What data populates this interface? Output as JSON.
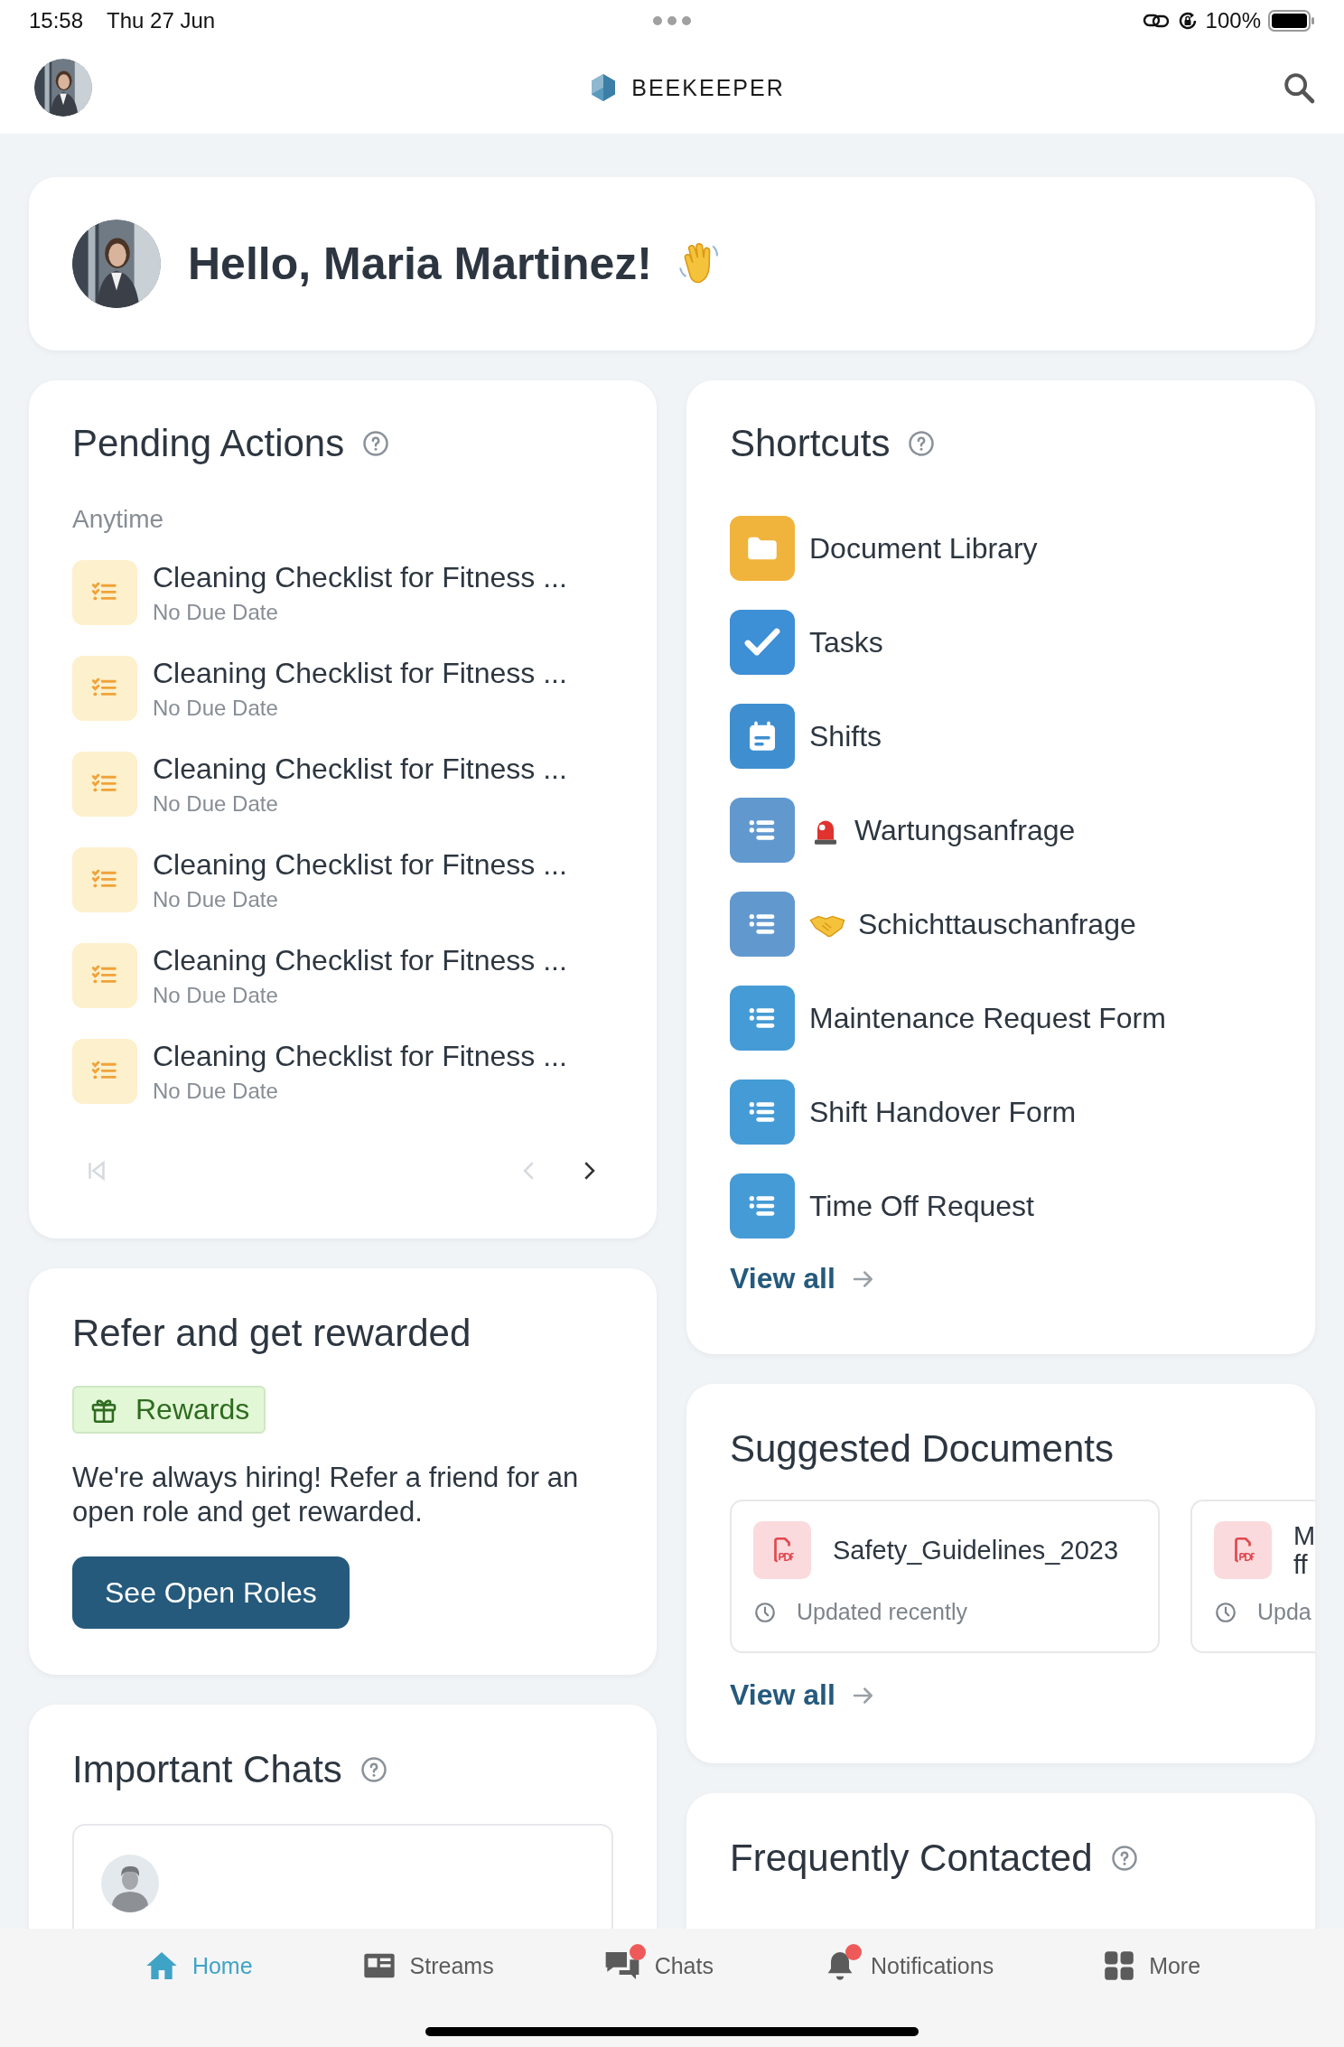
{
  "status_bar": {
    "time": "15:58",
    "date": "Thu 27 Jun",
    "battery": "100%"
  },
  "header": {
    "logo_text": "BEEKEEPER"
  },
  "greeting": {
    "text": "Hello, Maria Martinez!"
  },
  "pending_actions": {
    "title": "Pending Actions",
    "group": "Anytime",
    "items": [
      {
        "title": "Cleaning Checklist for Fitness ...",
        "due": "No Due Date"
      },
      {
        "title": "Cleaning Checklist for Fitness ...",
        "due": "No Due Date"
      },
      {
        "title": "Cleaning Checklist for Fitness ...",
        "due": "No Due Date"
      },
      {
        "title": "Cleaning Checklist for Fitness ...",
        "due": "No Due Date"
      },
      {
        "title": "Cleaning Checklist for Fitness ...",
        "due": "No Due Date"
      },
      {
        "title": "Cleaning Checklist for Fitness ...",
        "due": "No Due Date"
      }
    ],
    "pagination": {
      "first_disabled": true,
      "prev_disabled": true,
      "next_disabled": false
    }
  },
  "referral": {
    "title": "Refer and get rewarded",
    "tag": "Rewards",
    "text": "We're always hiring! Refer a friend for an open role and get rewarded.",
    "button": "See Open Roles"
  },
  "important_chats": {
    "title": "Important Chats"
  },
  "shortcuts": {
    "title": "Shortcuts",
    "items": [
      {
        "kind": "folder",
        "label": "Document Library"
      },
      {
        "kind": "tasks",
        "label": "Tasks"
      },
      {
        "kind": "shifts",
        "label": "Shifts"
      },
      {
        "kind": "siren_form",
        "label": "Wartungsanfrage"
      },
      {
        "kind": "handshake_form",
        "label": "Schichttauschanfrage"
      },
      {
        "kind": "form",
        "label": "Maintenance Request Form"
      },
      {
        "kind": "form",
        "label": "Shift Handover Form"
      },
      {
        "kind": "form",
        "label": "Time Off Request"
      }
    ],
    "view_all": "View all"
  },
  "suggested_documents": {
    "title": "Suggested Documents",
    "items": [
      {
        "name_lines": [
          "Safety_Guidelines_2023"
        ],
        "updated": "Updated recently"
      },
      {
        "name_lines": [
          "M",
          "ff"
        ],
        "updated": "Upda"
      }
    ],
    "view_all": "View all"
  },
  "frequently_contacted": {
    "title": "Frequently Contacted"
  },
  "bottom_nav": [
    {
      "kind": "home",
      "label": "Home",
      "selected": true,
      "badge": false
    },
    {
      "kind": "streams",
      "label": "Streams",
      "selected": false,
      "badge": false
    },
    {
      "kind": "chats",
      "label": "Chats",
      "selected": false,
      "badge": true
    },
    {
      "kind": "notifications",
      "label": "Notifications",
      "selected": false,
      "badge": true
    },
    {
      "kind": "more",
      "label": "More",
      "selected": false,
      "badge": false
    }
  ]
}
